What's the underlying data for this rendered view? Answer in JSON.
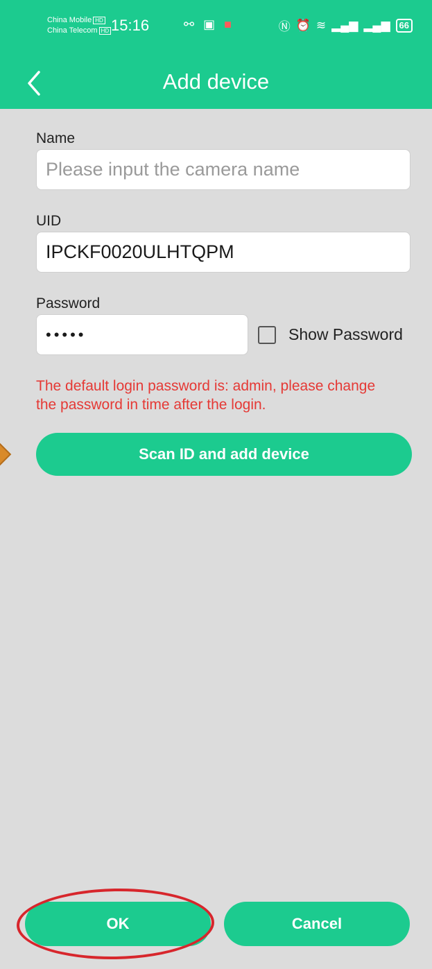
{
  "status_bar": {
    "carrier_1": "China Mobile",
    "carrier_2": "China Telecom",
    "carrier_badge": "HD",
    "time": "15:16",
    "battery": "66"
  },
  "header": {
    "title": "Add device",
    "back_icon": "chevron-left-icon"
  },
  "form": {
    "name_label": "Name",
    "name_placeholder": "Please input the camera name",
    "uid_label": "UID",
    "uid_value": "IPCKF0020ULHTQPM",
    "password_label": "Password",
    "password_value": "•••••",
    "show_password_label": "Show Password",
    "show_password_checked": false
  },
  "warning": "The default login password is: admin, please change the password in time after the login.",
  "buttons": {
    "scan_label": "Scan ID and add device",
    "ok_label": "OK",
    "cancel_label": "Cancel"
  },
  "colors": {
    "accent": "#1ccb8f",
    "warning": "#e53935",
    "highlight": "#d7262c",
    "background": "#dcdcdc"
  }
}
